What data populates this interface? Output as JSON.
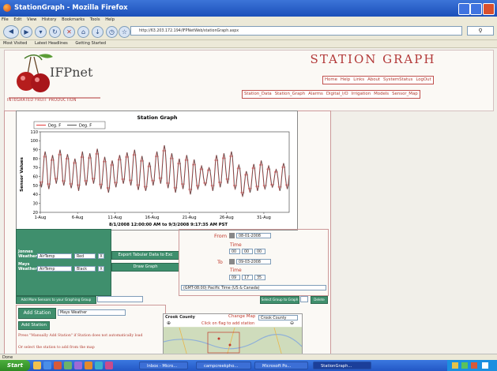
{
  "window": {
    "title": "StationGraph - Mozilla Firefox"
  },
  "menu": [
    "File",
    "Edit",
    "View",
    "History",
    "Bookmarks",
    "Tools",
    "Help"
  ],
  "url": "http://63.203.172.194/IFPNetWeb/stationGraph.aspx",
  "bookmarks": [
    "Most Visited",
    "Latest Headlines",
    "Getting Started"
  ],
  "logo": {
    "name": "IFPnet",
    "tagline": "INTEGRATED FRUIT PRODUCTION"
  },
  "page_title": "STATION GRAPH",
  "nav_top": [
    "Home",
    "Help",
    "Links",
    "About",
    "SystemStatus",
    "LogOut"
  ],
  "nav_sub": [
    "Station_Data",
    "Station_Graph",
    "Alarms",
    "Digital_I/O",
    "Irrigation",
    "Models",
    "Sensor_Map"
  ],
  "chart_data": {
    "type": "line",
    "title": "Station Graph",
    "ylabel": "Sensor Values",
    "xlabel": "8/1/2008 12:00:00 AM to 9/3/2008 9:17:35 AM PST",
    "ylim": [
      20,
      110
    ],
    "yticks": [
      20,
      30,
      40,
      50,
      60,
      70,
      80,
      90,
      100,
      110
    ],
    "categories": [
      "1-Aug",
      "6-Aug",
      "11-Aug",
      "16-Aug",
      "21-Aug",
      "26-Aug",
      "31-Aug"
    ],
    "days": [
      1,
      6,
      11,
      16,
      21,
      26,
      31
    ],
    "x_range_days": [
      1,
      34.4
    ],
    "series": [
      {
        "name": "Deg. F",
        "color": "#e23b3b",
        "daily_max": [
          88,
          84,
          90,
          85,
          80,
          88,
          86,
          91,
          82,
          78,
          84,
          87,
          90,
          83,
          76,
          88,
          95,
          86,
          80,
          84,
          79,
          72,
          70,
          84,
          86,
          88,
          73,
          66,
          74,
          78,
          72,
          68,
          75,
          77
        ],
        "daily_min": [
          48,
          46,
          52,
          50,
          47,
          44,
          50,
          52,
          46,
          42,
          48,
          52,
          50,
          45,
          44,
          50,
          52,
          47,
          42,
          46,
          40,
          46,
          50,
          44,
          48,
          52,
          46,
          38,
          42,
          44,
          46,
          48,
          44,
          46
        ]
      },
      {
        "name": "Deg. F",
        "color": "#555555",
        "daily_max": [
          88,
          84,
          90,
          85,
          80,
          88,
          86,
          91,
          82,
          78,
          84,
          87,
          90,
          83,
          76,
          88,
          95,
          86,
          80,
          84,
          79,
          72,
          70,
          84,
          86,
          88,
          73,
          66,
          74,
          78,
          72,
          68,
          75,
          77
        ],
        "daily_min": [
          48,
          46,
          52,
          50,
          47,
          44,
          50,
          52,
          46,
          42,
          48,
          52,
          50,
          45,
          44,
          50,
          52,
          47,
          42,
          46,
          40,
          46,
          50,
          44,
          48,
          52,
          46,
          38,
          42,
          44,
          46,
          48,
          44,
          46
        ]
      }
    ]
  },
  "controls": {
    "rows": [
      {
        "station": "Jonnes Weather",
        "sensor": "AirTemp",
        "color": "Red"
      },
      {
        "station": "Mays Weather",
        "sensor": "AirTemp",
        "color": "Black"
      }
    ],
    "remove_symbol": "X",
    "export_label": "Export Tabular Data to Exc",
    "draw_label": "Draw Graph",
    "from_label": "From",
    "from_date": "08-01-2008",
    "from_time_label": "Time",
    "from_time": [
      "00",
      "00",
      "00"
    ],
    "to_label": "To",
    "to_date": "09-03-2008",
    "to_time_label": "Time",
    "to_time": [
      "09",
      "17",
      "35"
    ],
    "timezone": "(GMT-08:00) Pacific Time (US & Canada)",
    "add_sensors_label": "Add More Sensors to your Graphing Group",
    "select_group_label": "Select Group to Graph",
    "delete_label": "Delete"
  },
  "add_station": {
    "label": "Add Station",
    "selected": "Mays Weather",
    "button": "Add Station",
    "hint": "Press \"Manually Add Station\" if Station does not automatically load",
    "hint2": "Or select the station to add from the map"
  },
  "map": {
    "county": "Crook County",
    "change_map_label": "Change Map",
    "change_map_value": "Crook County",
    "click_hint": "Click on flag to add station"
  },
  "statusbar": "Done",
  "taskbar": {
    "start": "Start",
    "items": [
      "Inbox - Micro...",
      "campcreekpho...",
      "Microsoft Po...",
      "StationGraph..."
    ]
  },
  "colors": {
    "accent": "#b23838",
    "green": "#3f8f6d",
    "taskbar": "#2357c5"
  }
}
